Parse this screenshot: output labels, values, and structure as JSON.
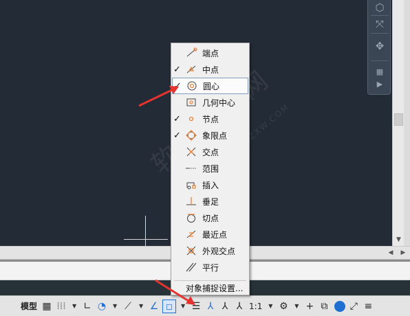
{
  "snap_menu": {
    "items": [
      {
        "label": "端点",
        "checked": false,
        "icon": "endpoint-icon"
      },
      {
        "label": "中点",
        "checked": true,
        "icon": "midpoint-icon"
      },
      {
        "label": "圆心",
        "checked": true,
        "icon": "center-icon"
      },
      {
        "label": "几何中心",
        "checked": false,
        "icon": "geometric-center-icon"
      },
      {
        "label": "节点",
        "checked": true,
        "icon": "node-icon"
      },
      {
        "label": "象限点",
        "checked": true,
        "icon": "quadrant-icon"
      },
      {
        "label": "交点",
        "checked": false,
        "icon": "intersection-icon"
      },
      {
        "label": "范围",
        "checked": false,
        "icon": "extension-icon"
      },
      {
        "label": "插入",
        "checked": false,
        "icon": "insertion-icon"
      },
      {
        "label": "垂足",
        "checked": false,
        "icon": "perpendicular-icon"
      },
      {
        "label": "切点",
        "checked": false,
        "icon": "tangent-icon"
      },
      {
        "label": "最近点",
        "checked": false,
        "icon": "nearest-icon"
      },
      {
        "label": "外观交点",
        "checked": false,
        "icon": "apparent-intersection-icon"
      },
      {
        "label": "平行",
        "checked": false,
        "icon": "parallel-icon"
      }
    ],
    "settings_label": "对象捕捉设置...",
    "check_mark": "✓"
  },
  "statusbar": {
    "model_label": "模型",
    "scale_label": "1:1",
    "icons": [
      "grid-icon",
      "snap-mode-icon",
      "ortho-icon",
      "polar-icon",
      "isodraft-icon",
      "osnap-tracking-icon",
      "object-snap-icon",
      "lineweight-icon",
      "annotation-visibility-icon",
      "auto-scale-icon",
      "annotation-scale-icon",
      "workspace-gear-icon",
      "plus-icon",
      "isolate-objects-icon",
      "hardware-acceleration-icon",
      "clean-screen-icon",
      "customization-menu-icon"
    ]
  },
  "watermark": {
    "text": "软件自学网",
    "url": "WWW.RJZXW.COM"
  },
  "colors": {
    "canvas": "#232b36",
    "accent": "#1f6fd1",
    "menu_bg": "#f0f0f0",
    "snap_icon": "#e8833a",
    "arrow": "#e3342f"
  }
}
